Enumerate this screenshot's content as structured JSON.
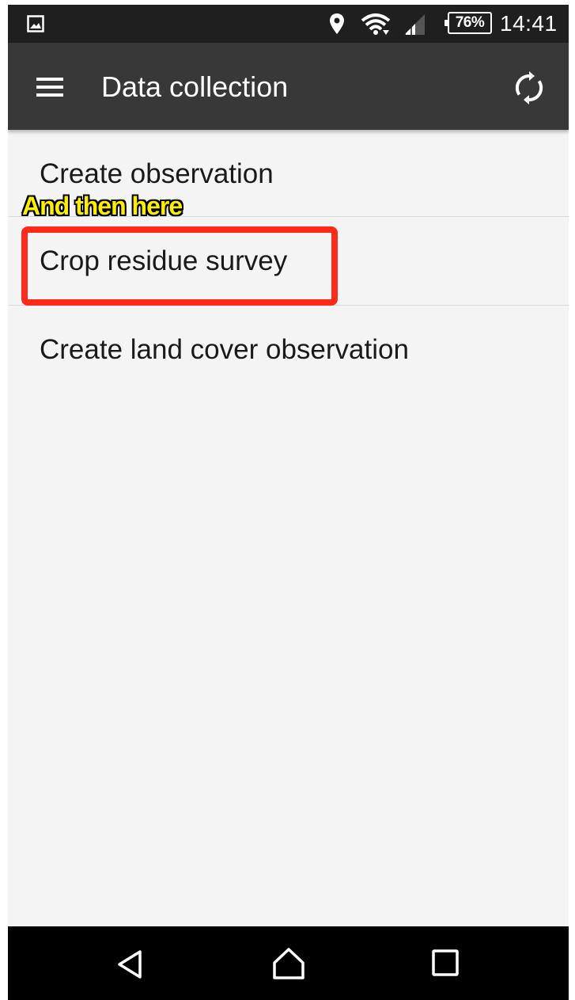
{
  "status_bar": {
    "battery": "76%",
    "time": "14:41",
    "icons": [
      "gallery-icon",
      "location-icon",
      "wifi-icon",
      "signal-icon",
      "battery-icon"
    ]
  },
  "app_bar": {
    "title": "Data collection",
    "icons": [
      "menu-icon",
      "sync-icon"
    ]
  },
  "menu": {
    "items": [
      {
        "label": "Create observation"
      },
      {
        "label": "Crop residue survey"
      },
      {
        "label": "Create land cover observation"
      }
    ]
  },
  "annotation": {
    "text": "And then here",
    "text_color": "#ffee00",
    "box_color": "#ff2a1a"
  },
  "nav_bar": {
    "icons": [
      "back-icon",
      "home-icon",
      "recents-icon"
    ]
  },
  "colors": {
    "status_bar": "#1f1f1f",
    "app_bar": "#383838",
    "content_bg": "#f4f4f4",
    "nav_bar": "#000000"
  }
}
